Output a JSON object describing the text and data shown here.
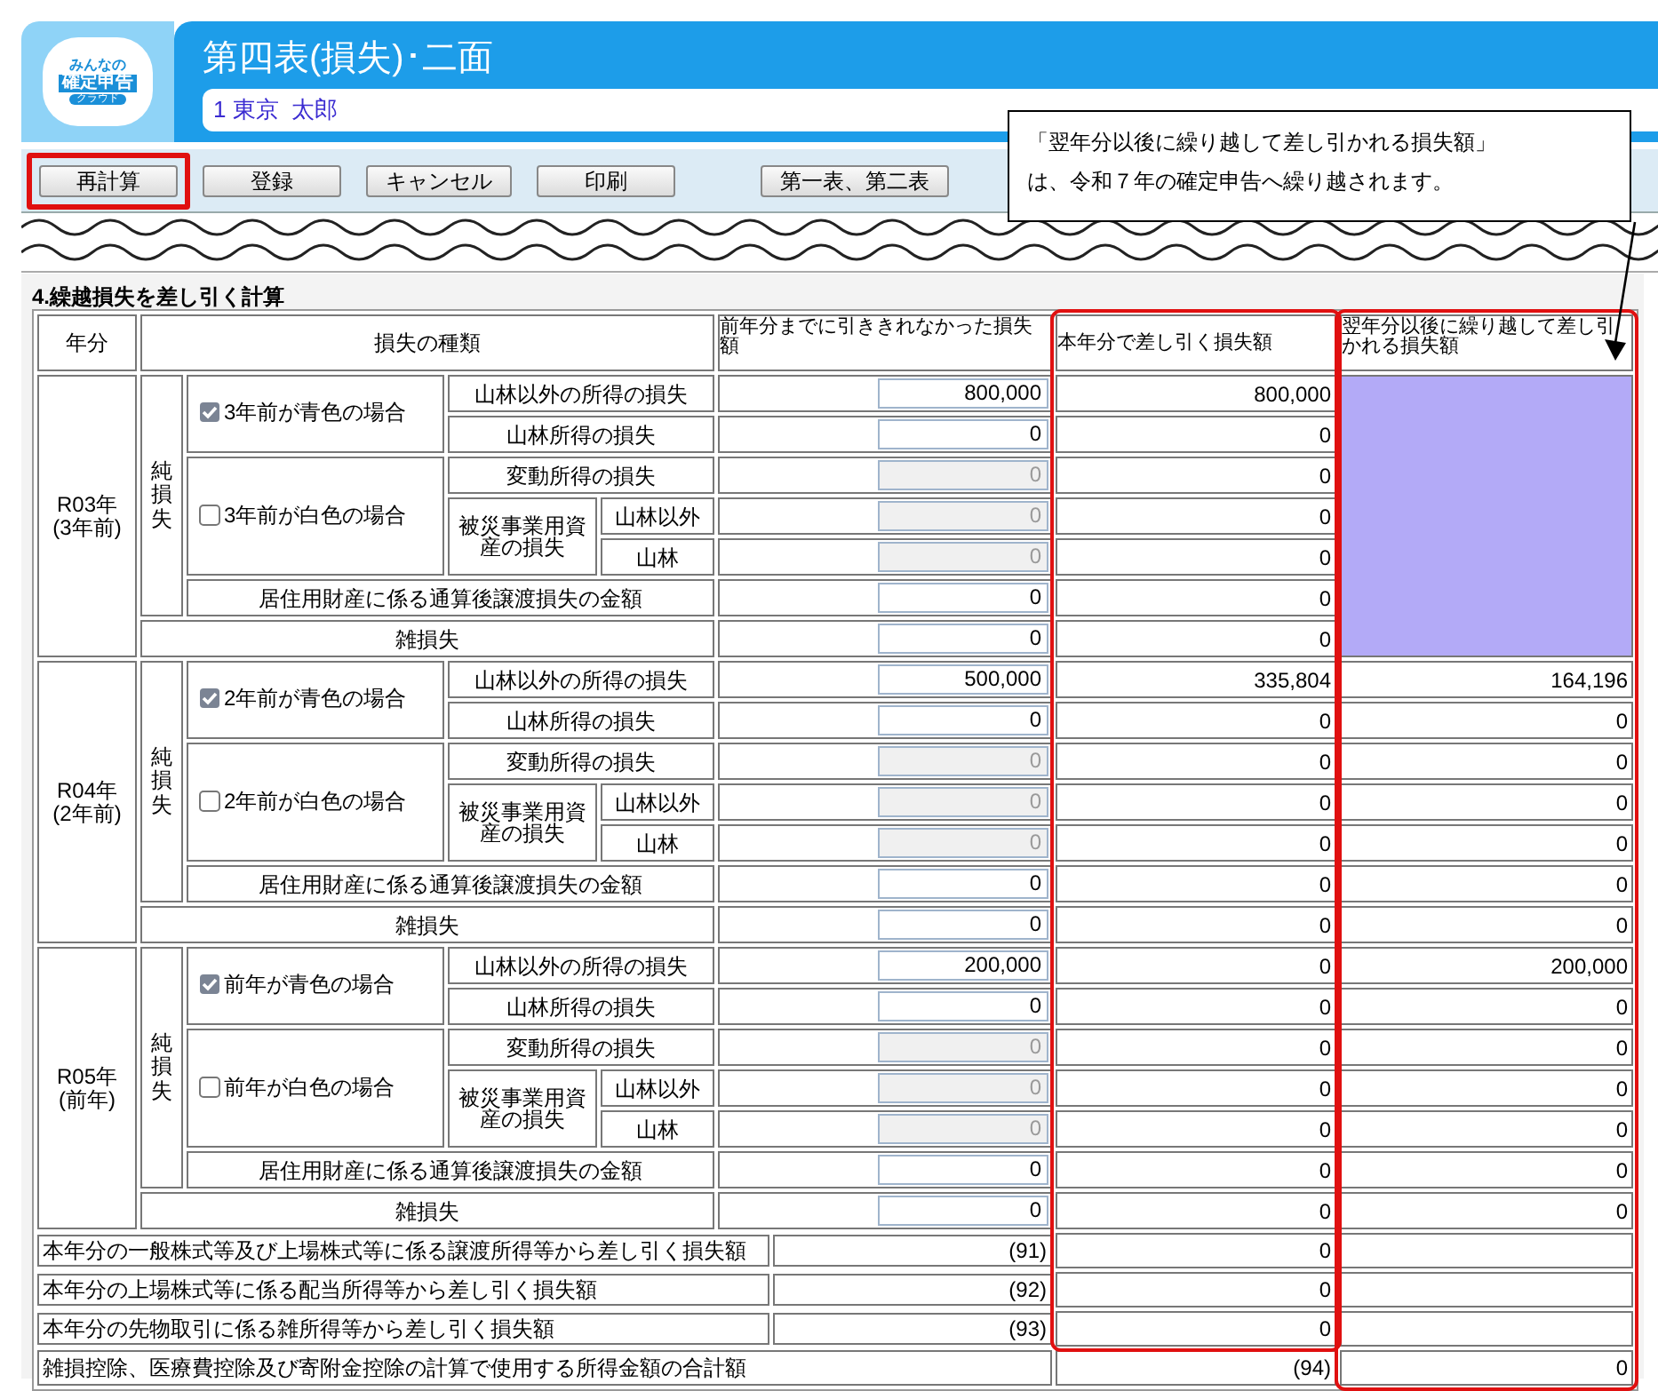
{
  "app": {
    "logo_lines": [
      "みんなの",
      "確定申告",
      "クラウド"
    ],
    "title": "第四表(損失)･二面",
    "taxpayer": "1 東京  太郎"
  },
  "toolbar": [
    {
      "label": "再計算",
      "highlighted": true
    },
    {
      "label": "登録",
      "highlighted": false
    },
    {
      "label": "キャンセル",
      "highlighted": false
    },
    {
      "label": "印刷",
      "highlighted": false
    },
    {
      "label": "第一表、第二表",
      "highlighted": false
    }
  ],
  "callout": {
    "lines": [
      "「翌年分以後に繰り越して差し引かれる損失額」",
      "は、令和７年の確定申告へ繰り越されます。"
    ]
  },
  "section_title": "4.繰越損失を差し引く計算",
  "table": {
    "columns": [
      {
        "label": "年分",
        "highlighted": false
      },
      {
        "label": "損失の種類",
        "highlighted": false
      },
      {
        "label": "前年分までに引ききれなかった損失額",
        "highlighted": false
      },
      {
        "label": "本年分で差し引く損失額",
        "highlighted": true
      },
      {
        "label": "翌年分以後に繰り越して差し引かれる損失額",
        "highlighted": true
      }
    ],
    "groups": [
      {
        "year": "R03年",
        "year_note": "(3年前)",
        "net_loss_label": "純損失",
        "blue_option": {
          "label": "3年前が青色の場合",
          "checked": true
        },
        "white_option": {
          "label": "3年前が白色の場合",
          "checked": false
        },
        "disaster_label": "被災事業用資産の損失",
        "carryforward_shaded": true,
        "rows": [
          {
            "label": "山林以外の所得の損失",
            "prior": "800,000",
            "prior_disabled": false,
            "current": "800,000"
          },
          {
            "label": "山林所得の損失",
            "prior": "0",
            "prior_disabled": false,
            "current": "0"
          },
          {
            "label": "変動所得の損失",
            "prior": "0",
            "prior_disabled": true,
            "current": "0"
          },
          {
            "label": "山林以外",
            "prior": "0",
            "prior_disabled": true,
            "current": "0"
          },
          {
            "label": "山林",
            "prior": "0",
            "prior_disabled": true,
            "current": "0"
          },
          {
            "label": "居住用財産に係る通算後譲渡損失の金額",
            "prior": "0",
            "prior_disabled": false,
            "current": "0"
          },
          {
            "label": "雑損失",
            "prior": "0",
            "prior_disabled": false,
            "current": "0"
          }
        ]
      },
      {
        "year": "R04年",
        "year_note": "(2年前)",
        "net_loss_label": "純損失",
        "blue_option": {
          "label": "2年前が青色の場合",
          "checked": true
        },
        "white_option": {
          "label": "2年前が白色の場合",
          "checked": false
        },
        "disaster_label": "被災事業用資産の損失",
        "carryforward_shaded": false,
        "rows": [
          {
            "label": "山林以外の所得の損失",
            "prior": "500,000",
            "prior_disabled": false,
            "current": "335,804",
            "next": "164,196"
          },
          {
            "label": "山林所得の損失",
            "prior": "0",
            "prior_disabled": false,
            "current": "0",
            "next": "0"
          },
          {
            "label": "変動所得の損失",
            "prior": "0",
            "prior_disabled": true,
            "current": "0",
            "next": "0"
          },
          {
            "label": "山林以外",
            "prior": "0",
            "prior_disabled": true,
            "current": "0",
            "next": "0"
          },
          {
            "label": "山林",
            "prior": "0",
            "prior_disabled": true,
            "current": "0",
            "next": "0"
          },
          {
            "label": "居住用財産に係る通算後譲渡損失の金額",
            "prior": "0",
            "prior_disabled": false,
            "current": "0",
            "next": "0"
          },
          {
            "label": "雑損失",
            "prior": "0",
            "prior_disabled": false,
            "current": "0",
            "next": "0"
          }
        ]
      },
      {
        "year": "R05年",
        "year_note": "(前年)",
        "net_loss_label": "純損失",
        "blue_option": {
          "label": "前年が青色の場合",
          "checked": true
        },
        "white_option": {
          "label": "前年が白色の場合",
          "checked": false
        },
        "disaster_label": "被災事業用資産の損失",
        "carryforward_shaded": false,
        "rows": [
          {
            "label": "山林以外の所得の損失",
            "prior": "200,000",
            "prior_disabled": false,
            "current": "0",
            "next": "200,000"
          },
          {
            "label": "山林所得の損失",
            "prior": "0",
            "prior_disabled": false,
            "current": "0",
            "next": "0"
          },
          {
            "label": "変動所得の損失",
            "prior": "0",
            "prior_disabled": true,
            "current": "0",
            "next": "0"
          },
          {
            "label": "山林以外",
            "prior": "0",
            "prior_disabled": true,
            "current": "0",
            "next": "0"
          },
          {
            "label": "山林",
            "prior": "0",
            "prior_disabled": true,
            "current": "0",
            "next": "0"
          },
          {
            "label": "居住用財産に係る通算後譲渡損失の金額",
            "prior": "0",
            "prior_disabled": false,
            "current": "0",
            "next": "0"
          },
          {
            "label": "雑損失",
            "prior": "0",
            "prior_disabled": false,
            "current": "0",
            "next": "0"
          }
        ]
      }
    ],
    "summary_rows": [
      {
        "kind": "deduction",
        "label": "本年分の一般株式等及び上場株式等に係る譲渡所得等から差し引く損失額",
        "number": "(91)",
        "current": "0"
      },
      {
        "kind": "deduction",
        "label": "本年分の上場株式等に係る配当所得等から差し引く損失額",
        "number": "(92)",
        "current": "0"
      },
      {
        "kind": "deduction",
        "label": "本年分の先物取引に係る雑所得等から差し引く損失額",
        "number": "(93)",
        "current": "0"
      },
      {
        "kind": "total",
        "label": "雑損控除、医療費控除及び寄附金控除の計算で使用する所得金額の合計額",
        "number": "(94)",
        "next": "0"
      }
    ]
  }
}
